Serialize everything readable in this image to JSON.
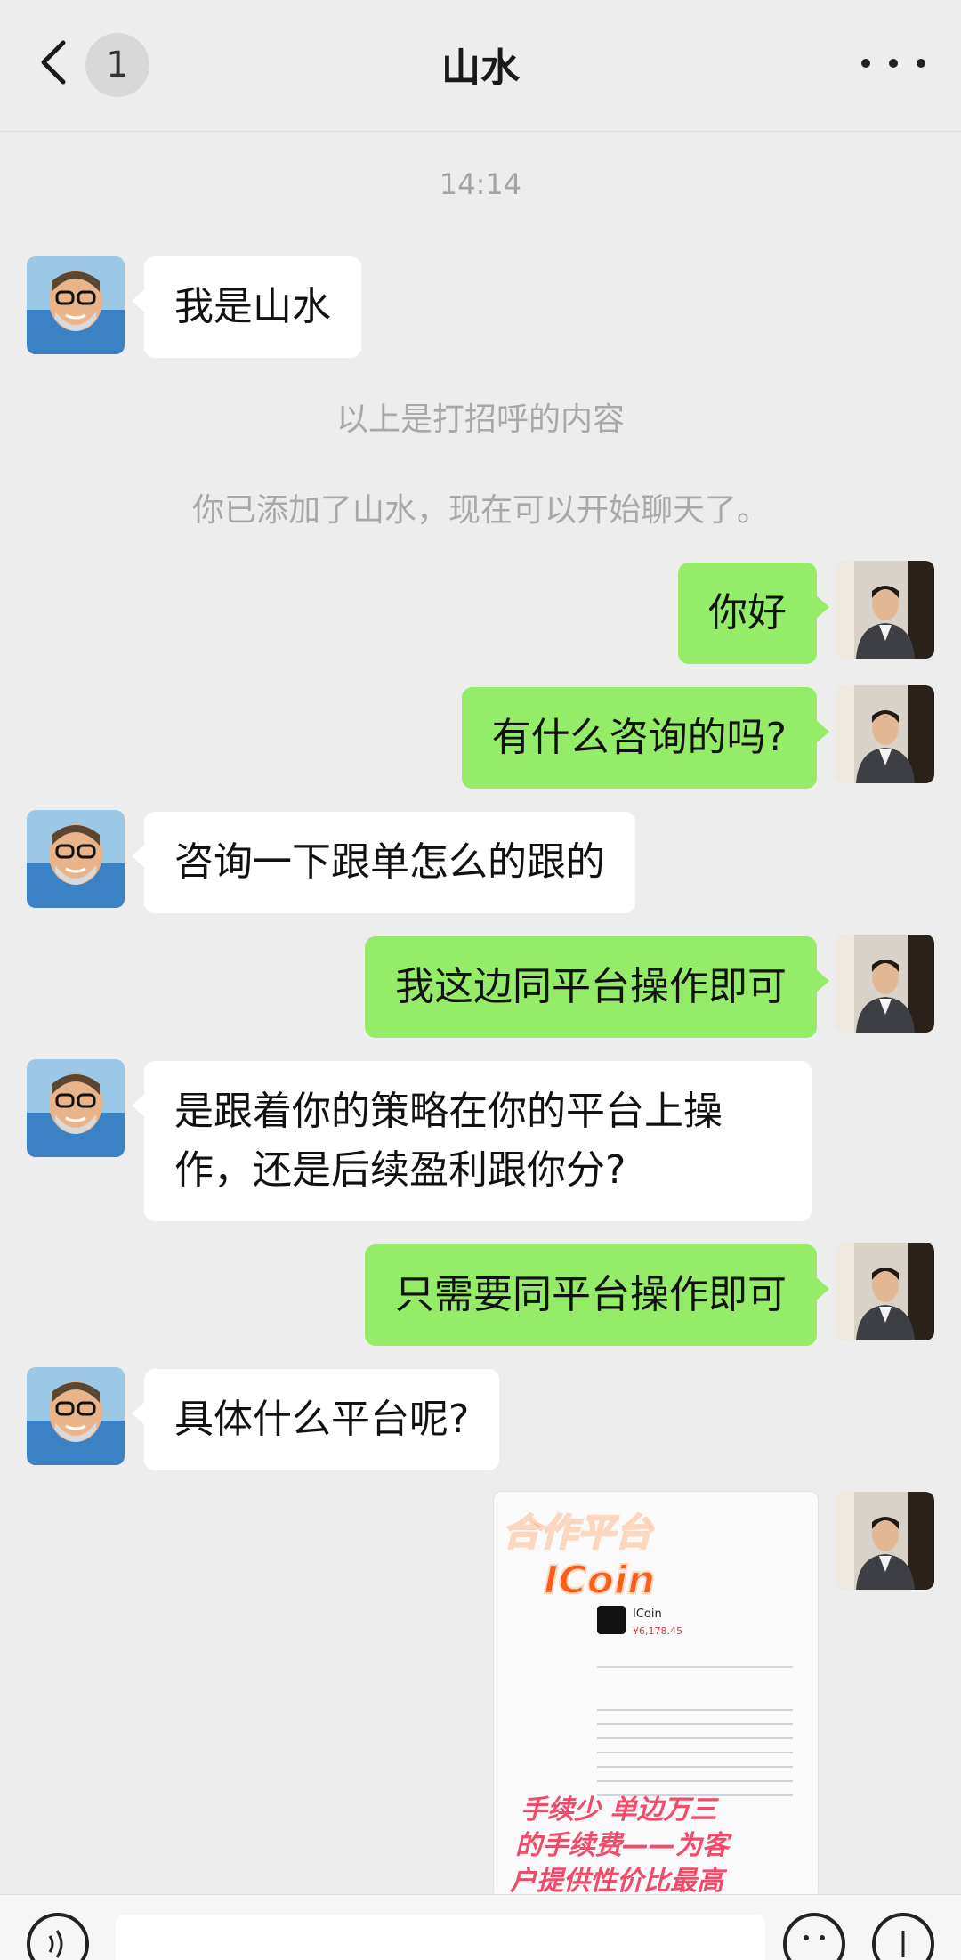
{
  "header": {
    "title": "山水",
    "unread_count": "1"
  },
  "chat": {
    "timestamp": "14:14",
    "system_messages": [
      "以上是打招呼的内容",
      "你已添加了山水，现在可以开始聊天了。"
    ],
    "messages": [
      {
        "side": "left",
        "text": "我是山水"
      },
      {
        "side": "right",
        "text": "你好"
      },
      {
        "side": "right",
        "text": "有什么咨询的吗?"
      },
      {
        "side": "left",
        "text": "咨询一下跟单怎么的跟的"
      },
      {
        "side": "right",
        "text": "我这边同平台操作即可"
      },
      {
        "side": "left",
        "text": "是跟着你的策略在你的平台上操作，还是后续盈利跟你分?"
      },
      {
        "side": "right",
        "text": "只需要同平台操作即可"
      },
      {
        "side": "left",
        "text": "具体什么平台呢?"
      }
    ],
    "image_message": {
      "headline_1": "合作平台",
      "headline_2": "ICoin",
      "app_name": "ICoin",
      "price": "¥6,178.45",
      "footer_1": "手续少 单边万三",
      "footer_2": "的手续费——为客",
      "footer_3": "户提供性价比最高"
    }
  },
  "colors": {
    "background": "#ededed",
    "sent_bubble": "#95ec69",
    "received_bubble": "#ffffff"
  }
}
